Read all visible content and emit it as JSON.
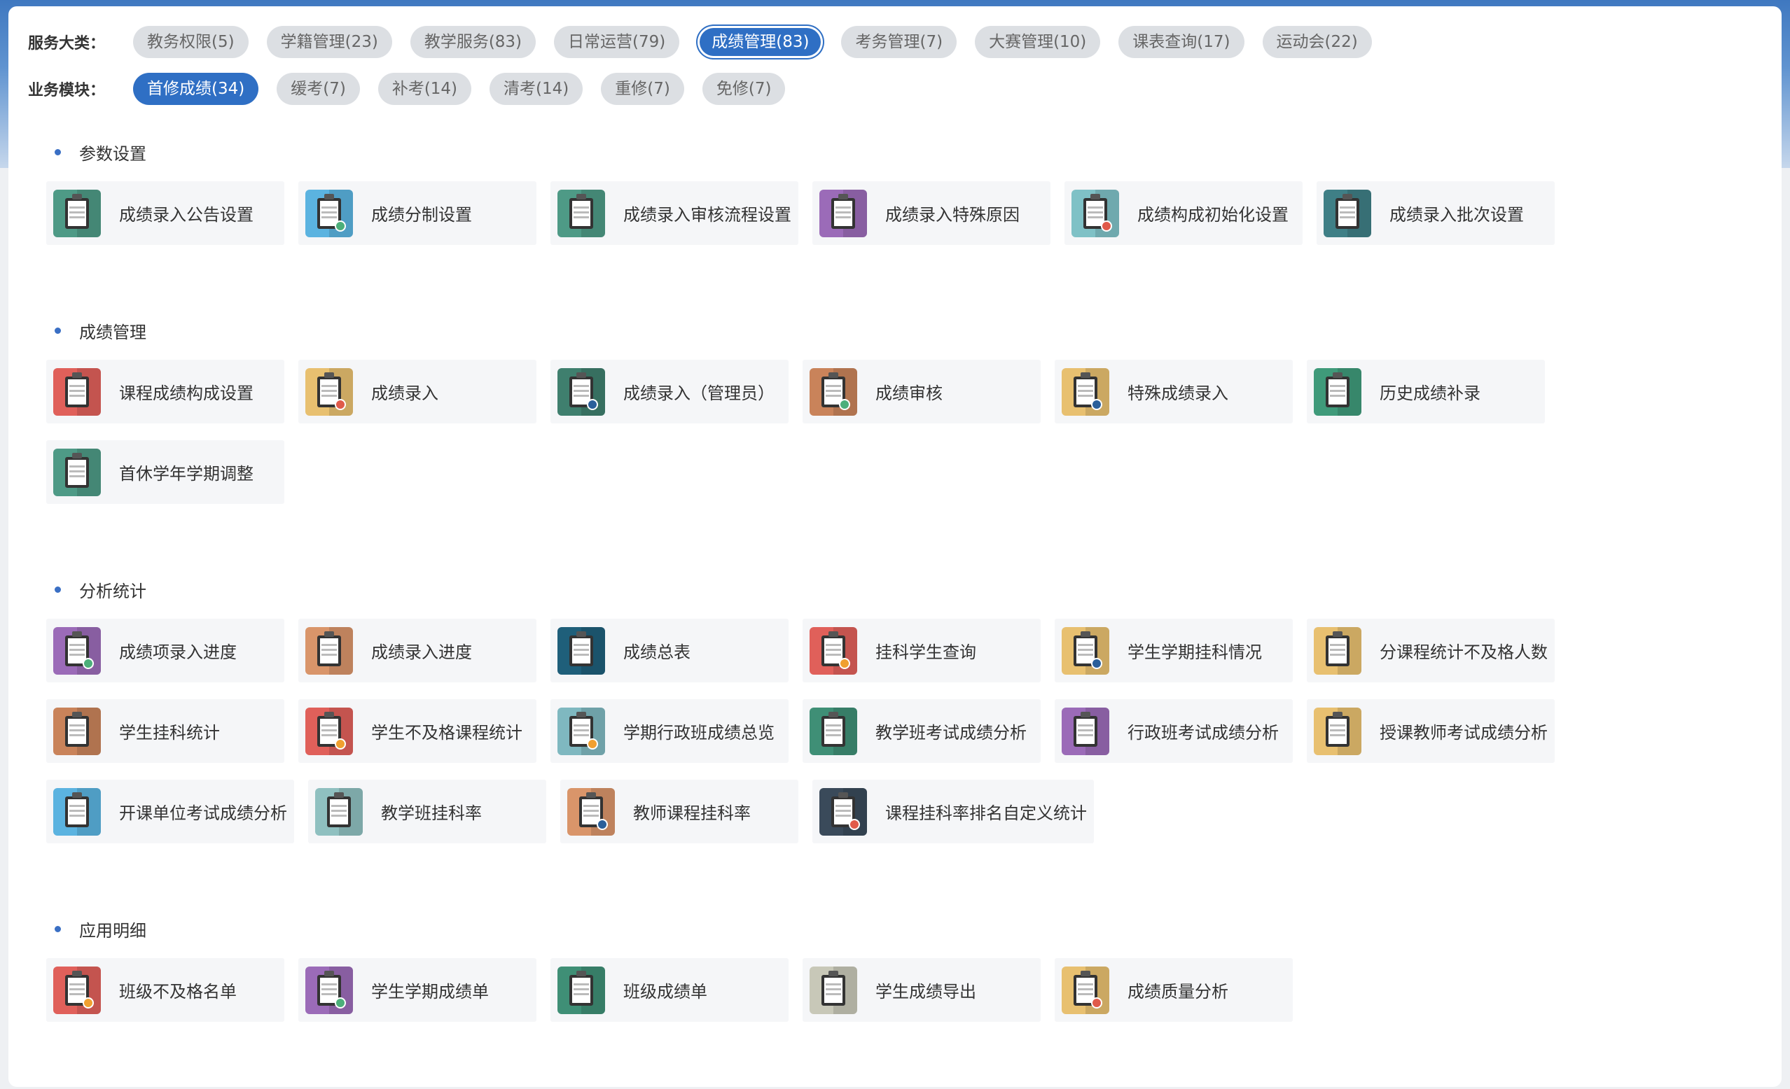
{
  "filters": {
    "service_label": "服务大类：",
    "service_chips": [
      {
        "label": "教务权限(5)",
        "active": false
      },
      {
        "label": "学籍管理(23)",
        "active": false
      },
      {
        "label": "教学服务(83)",
        "active": false
      },
      {
        "label": "日常运营(79)",
        "active": false
      },
      {
        "label": "成绩管理(83)",
        "active": true
      },
      {
        "label": "考务管理(7)",
        "active": false
      },
      {
        "label": "大赛管理(10)",
        "active": false
      },
      {
        "label": "课表查询(17)",
        "active": false
      },
      {
        "label": "运动会(22)",
        "active": false
      }
    ],
    "module_label": "业务模块：",
    "module_chips": [
      {
        "label": "首修成绩(34)",
        "active": true
      },
      {
        "label": "缓考(7)",
        "active": false
      },
      {
        "label": "补考(14)",
        "active": false
      },
      {
        "label": "清考(14)",
        "active": false
      },
      {
        "label": "重修(7)",
        "active": false
      },
      {
        "label": "免修(7)",
        "active": false
      }
    ]
  },
  "sections": [
    {
      "title": "参数设置",
      "items": [
        {
          "label": "成绩录入公告设置",
          "icon": "notice-board-icon",
          "color": "#4e9a86",
          "badge": ""
        },
        {
          "label": "成绩分制设置",
          "icon": "clipboard-search-icon",
          "color": "#5bb3e0",
          "badge": "#4caf7a"
        },
        {
          "label": "成绩录入审核流程设置",
          "icon": "alert-board-icon",
          "color": "#4e9a86",
          "badge": ""
        },
        {
          "label": "成绩录入特殊原因",
          "icon": "clipboard-icon",
          "color": "#9b6bb8",
          "badge": ""
        },
        {
          "label": "成绩构成初始化设置",
          "icon": "clipboard-gear-icon",
          "color": "#7fc1c6",
          "badge": "#e05a4a"
        },
        {
          "label": "成绩录入批次设置",
          "icon": "clipboard-clock-icon",
          "color": "#3f7f86",
          "badge": ""
        }
      ]
    },
    {
      "title": "成绩管理",
      "items": [
        {
          "label": "课程成绩构成设置",
          "icon": "cube-icon",
          "color": "#e0605a",
          "badge": ""
        },
        {
          "label": "成绩录入",
          "icon": "clipboard-chart-icon",
          "color": "#e8c070",
          "badge": "#e05a4a"
        },
        {
          "label": "成绩录入（管理员）",
          "icon": "clipboard-tools-icon",
          "color": "#3f7f6e",
          "badge": "#2a5f9a"
        },
        {
          "label": "成绩审核",
          "icon": "clipboard-check-icon",
          "color": "#c9835a",
          "badge": "#4caf7a"
        },
        {
          "label": "特殊成绩录入",
          "icon": "clipboard-edit-icon",
          "color": "#e8c070",
          "badge": "#2a5f9a"
        },
        {
          "label": "历史成绩补录",
          "icon": "document-icon",
          "color": "#3f9a7a",
          "badge": ""
        },
        {
          "label": "首休学年学期调整",
          "icon": "clipboard-timer-icon",
          "color": "#4e9a86",
          "badge": ""
        }
      ]
    },
    {
      "title": "分析统计",
      "items": [
        {
          "label": "成绩项录入进度",
          "icon": "clipboard-progress-icon",
          "color": "#9b6bb8",
          "badge": "#4caf7a"
        },
        {
          "label": "成绩录入进度",
          "icon": "document-progress-icon",
          "color": "#d9956a",
          "badge": ""
        },
        {
          "label": "成绩总表",
          "icon": "calendar-check-icon",
          "color": "#1f5f7a",
          "badge": ""
        },
        {
          "label": "挂科学生查询",
          "icon": "screen-search-icon",
          "color": "#e0605a",
          "badge": "#f0a030"
        },
        {
          "label": "学生学期挂科情况",
          "icon": "clipboard-edit-icon",
          "color": "#e8c070",
          "badge": "#2a5f9a"
        },
        {
          "label": "分课程统计不及格人数",
          "icon": "monitor-icon",
          "color": "#e8c070",
          "badge": ""
        },
        {
          "label": "学生挂科统计",
          "icon": "clipboard-c-icon",
          "color": "#c9835a",
          "badge": ""
        },
        {
          "label": "学生不及格课程统计",
          "icon": "chart-monitor-icon",
          "color": "#e0605a",
          "badge": "#f0a030"
        },
        {
          "label": "学期行政班成绩总览",
          "icon": "clipboard-user-icon",
          "color": "#7fb8c0",
          "badge": "#f0a030"
        },
        {
          "label": "教学班考试成绩分析",
          "icon": "copy-document-icon",
          "color": "#3f8f76",
          "badge": ""
        },
        {
          "label": "行政班考试成绩分析",
          "icon": "edit-document-icon",
          "color": "#9b6bb8",
          "badge": ""
        },
        {
          "label": "授课教师考试成绩分析",
          "icon": "edit-document-icon",
          "color": "#e8c070",
          "badge": ""
        },
        {
          "label": "开课单位考试成绩分析",
          "icon": "edit-document-icon",
          "color": "#5bb3e0",
          "badge": ""
        },
        {
          "label": "教学班挂科率",
          "icon": "presentation-icon",
          "color": "#8fc0c0",
          "badge": ""
        },
        {
          "label": "教师课程挂科率",
          "icon": "monitor-chart-icon",
          "color": "#d9956a",
          "badge": "#2a5f9a"
        },
        {
          "label": "课程挂科率排名自定义统计",
          "icon": "chart-screen-icon",
          "color": "#3a4a5a",
          "badge": "#e05a4a"
        }
      ]
    },
    {
      "title": "应用明细",
      "items": [
        {
          "label": "班级不及格名单",
          "icon": "chart-monitor-icon",
          "color": "#e0605a",
          "badge": "#f0a030"
        },
        {
          "label": "学生学期成绩单",
          "icon": "clipboard-search-icon",
          "color": "#9b6bb8",
          "badge": "#4caf7a"
        },
        {
          "label": "班级成绩单",
          "icon": "id-card-icon",
          "color": "#3f8f76",
          "badge": ""
        },
        {
          "label": "学生成绩导出",
          "icon": "presentation-icon",
          "color": "#c8c8b8",
          "badge": ""
        },
        {
          "label": "成绩质量分析",
          "icon": "clipboard-chart-icon",
          "color": "#e8c070",
          "badge": "#e05a4a"
        }
      ]
    }
  ]
}
